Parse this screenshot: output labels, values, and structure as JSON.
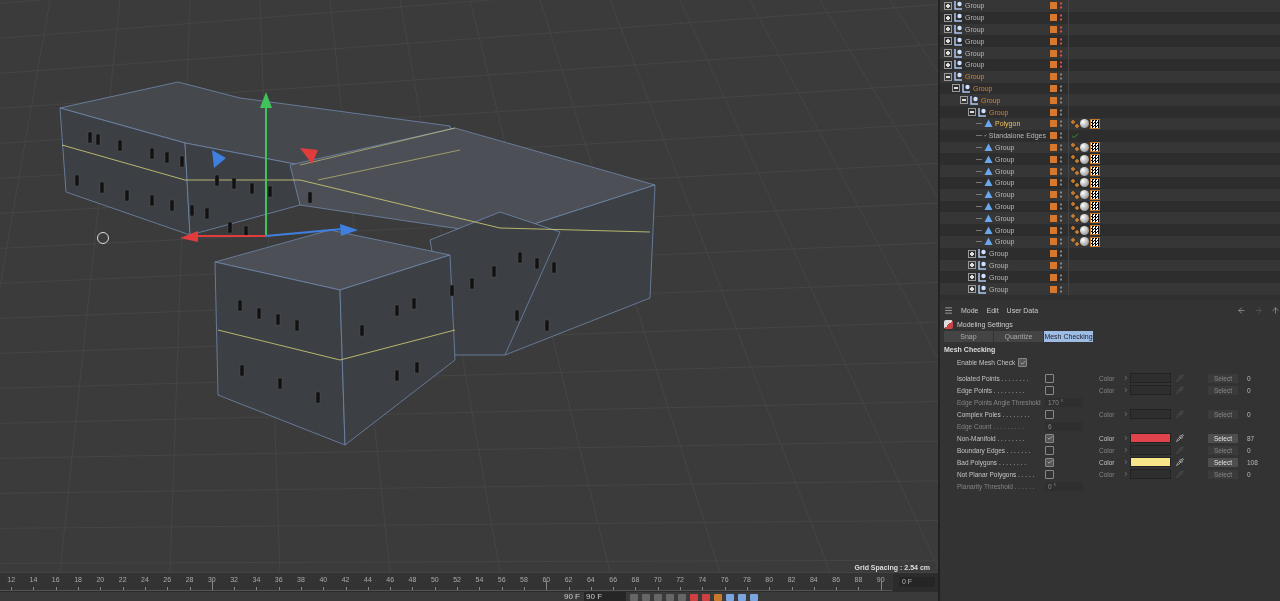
{
  "viewport": {
    "grid_spacing": "Grid Spacing : 2.54 cm"
  },
  "object_manager": {
    "objects": [
      {
        "name": "Group",
        "kind": "null",
        "selected": false,
        "hidden": true,
        "expanded": false
      },
      {
        "name": "Group",
        "kind": "null",
        "selected": false,
        "hidden": true,
        "expanded": false
      },
      {
        "name": "Group",
        "kind": "null",
        "selected": false,
        "hidden": true,
        "expanded": false
      },
      {
        "name": "Group",
        "kind": "null",
        "selected": false,
        "hidden": true,
        "expanded": false
      },
      {
        "name": "Group",
        "kind": "null",
        "selected": false,
        "hidden": true,
        "expanded": false
      },
      {
        "name": "Group",
        "kind": "null",
        "selected": false,
        "hidden": true,
        "expanded": false
      },
      {
        "name": "Group",
        "kind": "null",
        "selected": true,
        "hidden": false,
        "expanded": true,
        "children": [
          {
            "name": "Group",
            "kind": "null",
            "selected": true,
            "hidden": false,
            "expanded": true,
            "children": [
              {
                "name": "Group",
                "kind": "null",
                "selected": true,
                "hidden": false,
                "expanded": true,
                "children": [
                  {
                    "name": "Group",
                    "kind": "null",
                    "selected": true,
                    "hidden": false,
                    "expanded": true,
                    "children": [
                      {
                        "name": "Polygon",
                        "kind": "polygon",
                        "selected": true,
                        "active": true,
                        "hidden": false
                      },
                      {
                        "name": "Standalone Edges",
                        "kind": "spline",
                        "selected": false,
                        "hidden": false
                      },
                      {
                        "name": "Group",
                        "kind": "polygon",
                        "selected": false,
                        "hidden": false
                      },
                      {
                        "name": "Group",
                        "kind": "polygon",
                        "selected": false,
                        "hidden": false
                      },
                      {
                        "name": "Group",
                        "kind": "polygon",
                        "selected": false,
                        "hidden": false
                      },
                      {
                        "name": "Group",
                        "kind": "polygon",
                        "selected": false,
                        "hidden": false
                      },
                      {
                        "name": "Group",
                        "kind": "polygon",
                        "selected": false,
                        "hidden": false
                      },
                      {
                        "name": "Group",
                        "kind": "polygon",
                        "selected": false,
                        "hidden": false
                      },
                      {
                        "name": "Group",
                        "kind": "polygon",
                        "selected": false,
                        "hidden": false
                      },
                      {
                        "name": "Group",
                        "kind": "polygon",
                        "selected": false,
                        "hidden": false
                      },
                      {
                        "name": "Group",
                        "kind": "polygon",
                        "selected": false,
                        "hidden": false
                      }
                    ]
                  },
                  {
                    "name": "Group",
                    "kind": "null",
                    "selected": false,
                    "hidden": false,
                    "expanded": false
                  },
                  {
                    "name": "Group",
                    "kind": "null",
                    "selected": false,
                    "hidden": false,
                    "expanded": false
                  },
                  {
                    "name": "Group",
                    "kind": "null",
                    "selected": false,
                    "hidden": false,
                    "expanded": false
                  },
                  {
                    "name": "Group",
                    "kind": "null",
                    "selected": false,
                    "hidden": false,
                    "expanded": false
                  }
                ]
              }
            ]
          }
        ]
      }
    ]
  },
  "attributes": {
    "menu": [
      "Mode",
      "Edit",
      "User Data"
    ],
    "title": "Modeling Settings",
    "tabs": [
      {
        "label": "Snap",
        "selected": false
      },
      {
        "label": "Quantize",
        "selected": false
      },
      {
        "label": "Mesh Checking",
        "selected": true
      }
    ],
    "section": "Mesh Checking",
    "enable": {
      "label": "Enable Mesh Check",
      "checked": true
    },
    "rows": [
      {
        "kind": "check",
        "label": "Isolated Points . . . . . . . .",
        "checked": false,
        "color_label": "Color",
        "button": "Select",
        "count": "0"
      },
      {
        "kind": "check",
        "label": "Edge Points . . . . . . . . .",
        "checked": false,
        "color_label": "Color",
        "button": "Select",
        "count": "0"
      },
      {
        "kind": "param",
        "label": "Edge Points Angle Threshold",
        "value": "170 °"
      },
      {
        "kind": "check",
        "label": "Complex Poles . . . . . . . .",
        "checked": false,
        "color_label": "Color",
        "button": "Select",
        "count": "0"
      },
      {
        "kind": "param",
        "label": "Edge Count . . . . . . . . .",
        "value": "6"
      },
      {
        "kind": "check",
        "label": "Non-Manifold . . . . . . . .",
        "checked": true,
        "color_label": "Color",
        "color": "#e0434b",
        "button": "Select",
        "count": "87"
      },
      {
        "kind": "check",
        "label": "Boundary Edges . . . . . . .",
        "checked": false,
        "color_label": "Color",
        "button": "Select",
        "count": "0"
      },
      {
        "kind": "check",
        "label": "Bad Polygons . . . . . . . .",
        "checked": true,
        "color_label": "Color",
        "color": "#f7e58a",
        "button": "Select",
        "count": "108"
      },
      {
        "kind": "check",
        "label": "Not Planar Polygons . . . . .",
        "checked": false,
        "color_label": "Color",
        "button": "Select",
        "count": "0"
      },
      {
        "kind": "param",
        "label": "Planarity Threshold . . . . . .",
        "value": "0 °"
      }
    ]
  },
  "timeline": {
    "ticks": [
      "12",
      "14",
      "16",
      "18",
      "20",
      "22",
      "24",
      "26",
      "28",
      "30",
      "32",
      "34",
      "36",
      "38",
      "40",
      "42",
      "44",
      "46",
      "48",
      "50",
      "52",
      "54",
      "56",
      "58",
      "60",
      "62",
      "64",
      "66",
      "68",
      "70",
      "72",
      "74",
      "76",
      "78",
      "80",
      "82",
      "84",
      "86",
      "88",
      "90"
    ],
    "current_frame": "0 F",
    "end_label": "90 F",
    "end_field": "90 F"
  }
}
